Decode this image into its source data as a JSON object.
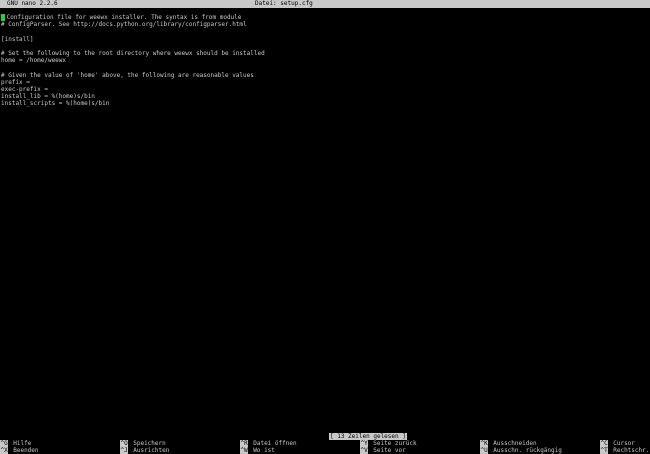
{
  "titlebar": {
    "app": "GNU nano 2.2.6",
    "file": "Datei: setup.cfg"
  },
  "editor": {
    "lines": [
      "Configuration file for weewx installer. The syntax is from module",
      "# ConfigParser. See http://docs.python.org/library/configparser.html",
      "",
      "[install]",
      "",
      "# Set the following to the root directory where weewx should be installed",
      "home = /home/weewx",
      "",
      "# Given the value of 'home' above, the following are reasonable values",
      "prefix =",
      "exec-prefix =",
      "install_lib = %(home)s/bin",
      "install_scripts = %(home)s/bin"
    ],
    "cursor_color": "#2ecc40"
  },
  "status": {
    "message": "[ 13 Zeilen gelesen ]"
  },
  "shortcuts": {
    "row1": [
      {
        "key": "^G",
        "label": "Hilfe"
      },
      {
        "key": "^O",
        "label": "Speichern"
      },
      {
        "key": "^R",
        "label": "Datei öffnen"
      },
      {
        "key": "^Y",
        "label": "Seite zurück"
      },
      {
        "key": "^K",
        "label": "Ausschneiden"
      },
      {
        "key": "^C",
        "label": "Cursor"
      }
    ],
    "row2": [
      {
        "key": "^X",
        "label": "Beenden"
      },
      {
        "key": "^J",
        "label": "Ausrichten"
      },
      {
        "key": "^W",
        "label": "Wo ist"
      },
      {
        "key": "^V",
        "label": "Seite vor"
      },
      {
        "key": "^U",
        "label": "Ausschn. rückgängig"
      },
      {
        "key": "^T",
        "label": "Rechtschr."
      }
    ]
  },
  "colors": {
    "background": "#000000",
    "foreground": "#c8c8c8",
    "inverse_bg": "#c8c8c8",
    "inverse_fg": "#000000"
  }
}
